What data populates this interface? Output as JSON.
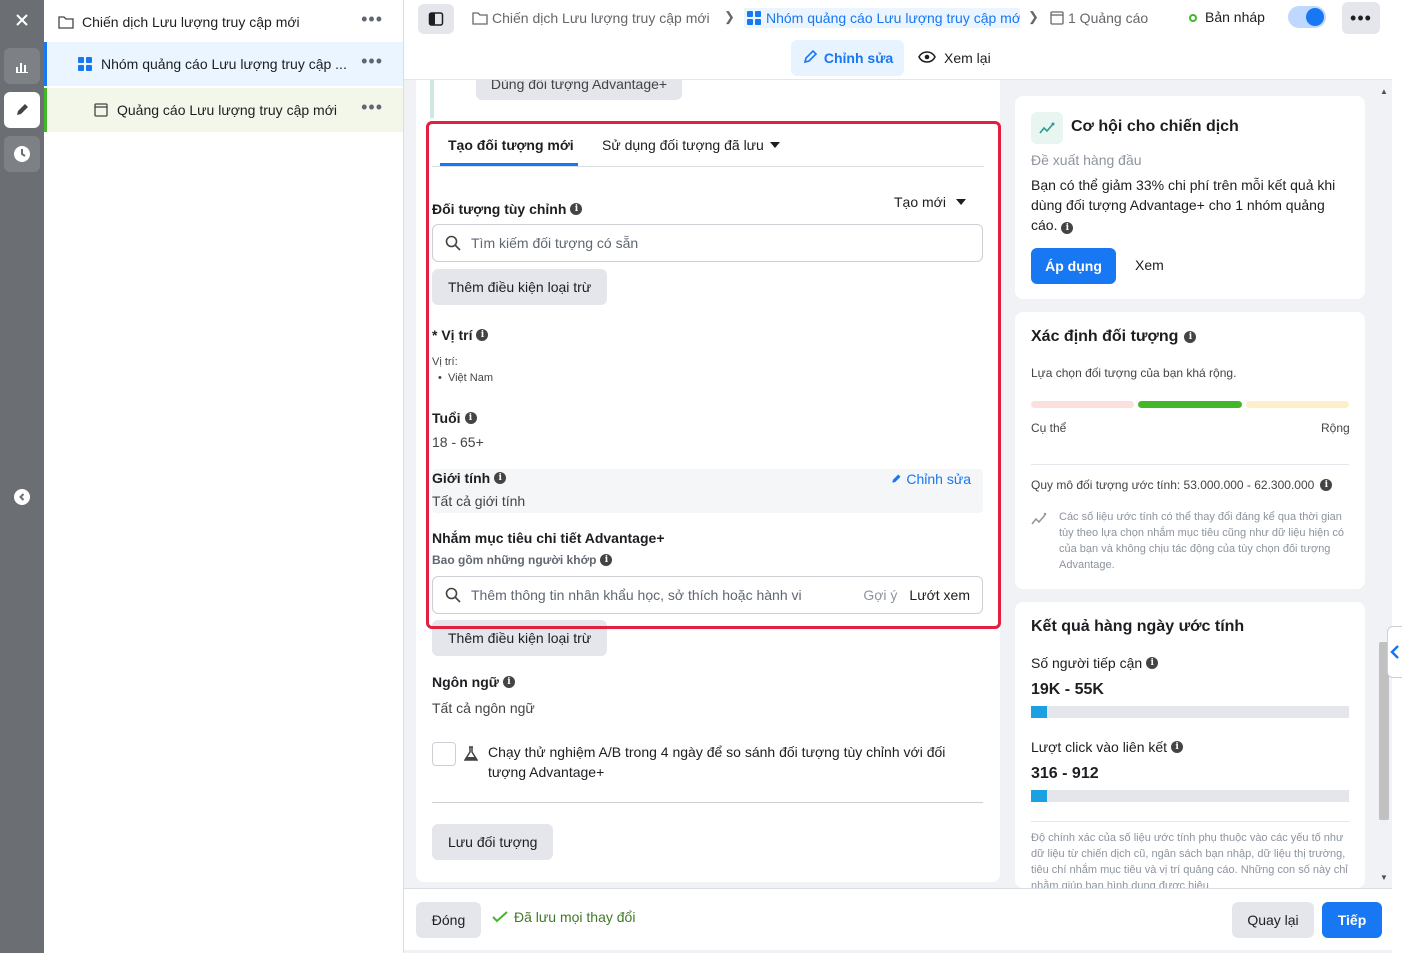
{
  "tree": {
    "campaign": "Chiến dịch Lưu lượng truy cập mới",
    "adset": "Nhóm quảng cáo Lưu lượng truy cập ...",
    "ad": "Quảng cáo Lưu lượng truy cập mới",
    "more": "•••"
  },
  "header": {
    "crumb_campaign": "Chiến dịch Lưu lượng truy cập mới",
    "crumb_adset": "Nhóm quảng cáo Lưu lượng truy cập mớ",
    "crumb_ads": "1 Quảng cáo",
    "status": "Bản nháp",
    "more": "•••",
    "edit_label": "Chỉnh sửa",
    "review_label": "Xem lại"
  },
  "form": {
    "cut_button": "Dùng đối tượng Advantage+",
    "tab_new": "Tạo đối tượng mới",
    "tab_saved": "Sử dụng đối tượng đã lưu",
    "custom_audience_label": "Đối tượng tùy chỉnh",
    "create_new": "Tạo mới",
    "custom_search_placeholder": "Tìm kiếm đối tượng có sẵn",
    "add_exclusion": "Thêm điều kiện loại trừ",
    "location_label": "* Vị trí",
    "location_sub": "Vị trí:",
    "location_item": "Việt Nam",
    "age_label": "Tuổi",
    "age_value": "18 - 65+",
    "gender_label": "Giới tính",
    "gender_edit": "Chỉnh sửa",
    "gender_value": "Tất cả giới tính",
    "detailed_label": "Nhắm mục tiêu chi tiết Advantage",
    "detailed_plus": "+",
    "include_label": "Bao gồm những người khớp",
    "detailed_placeholder": "Thêm thông tin nhân khẩu học, sở thích hoặc hành vi",
    "suggest": "Gợi ý",
    "browse": "Lướt xem",
    "add_exclusion_2": "Thêm điều kiện loại trừ",
    "language_label": "Ngôn ngữ",
    "language_value": "Tất cả ngôn ngữ",
    "ab_test": "Chạy thử nghiệm A/B trong 4 ngày để so sánh đối tượng tùy chỉnh với đối tượng Advantage+",
    "save_audience": "Lưu đối tượng"
  },
  "opportunity": {
    "title": "Cơ hội cho chiến dịch",
    "subtitle": "Đề xuất hàng đầu",
    "body": "Bạn có thể giảm 33% chi phí trên mỗi kết quả khi dùng đối tượng Advantage+ cho 1 nhóm quảng cáo.",
    "apply": "Áp dụng",
    "view": "Xem"
  },
  "audience_def": {
    "title": "Xác định đối tượng",
    "summary": "Lựa chọn đối tượng của bạn khá rộng.",
    "specific": "Cụ thể",
    "broad": "Rộng",
    "meter_level": "broad",
    "size": "Quy mô đối tượng ước tính: 53.000.000 - 62.300.000",
    "note": "Các số liệu ước tính có thể thay đổi đáng kể qua thời gian tùy theo lựa chọn nhắm mục tiêu cũng như dữ liệu hiện có của bạn và không chịu tác động của tùy chọn đối tượng Advantage."
  },
  "results": {
    "title": "Kết quả hàng ngày ước tính",
    "reach_label": "Số người tiếp cận",
    "reach_value": "19K - 55K",
    "reach_fill": 0.05,
    "clicks_label": "Lượt click vào liên kết",
    "clicks_value": "316 - 912",
    "clicks_fill": 0.05,
    "note": "Độ chính xác của số liệu ước tính phụ thuộc vào các yếu tố như dữ liệu từ chiến dịch cũ, ngân sách bạn nhập, dữ liệu thị trường, tiêu chí nhắm mục tiêu và vị trí quảng cáo. Những con số này chỉ nhằm giúp bạn hình dung được hiệu"
  },
  "footer": {
    "close": "Đóng",
    "saved": "Đã lưu mọi thay đổi",
    "back": "Quay lại",
    "next": "Tiếp"
  },
  "colors": {
    "accent": "#1877f2",
    "highlight": "#e41e3f",
    "success": "#42b72a"
  }
}
